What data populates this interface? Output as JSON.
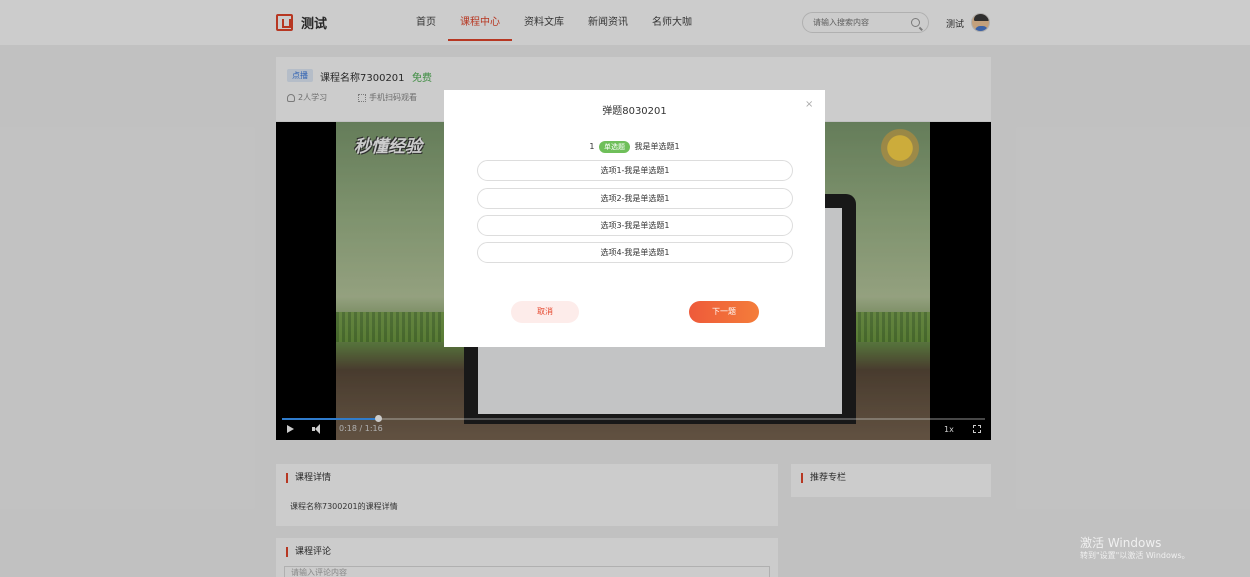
{
  "header": {
    "logo_text": "测试",
    "nav": [
      {
        "label": "首页",
        "active": false
      },
      {
        "label": "课程中心",
        "active": true
      },
      {
        "label": "资料文库",
        "active": false
      },
      {
        "label": "新闻资讯",
        "active": false
      },
      {
        "label": "名师大咖",
        "active": false
      }
    ],
    "search_placeholder": "请输入搜索内容",
    "user_name": "测试"
  },
  "course": {
    "tag": "点播",
    "name": "课程名称7300201",
    "price": "免费",
    "learners": "2人学习",
    "mobile": "手机扫码观看"
  },
  "player": {
    "watermark": "秒懂经验",
    "time": "0:18 / 1:16",
    "progress": 0.137,
    "rate": "1x"
  },
  "detail": {
    "title": "课程详情",
    "text": "课程名称7300201的课程详情"
  },
  "recommend": {
    "title": "推荐专栏"
  },
  "comments": {
    "title": "课程评论",
    "placeholder": "请输入评论内容"
  },
  "modal": {
    "title": "弹题8030201",
    "close": "×",
    "question_no": "1",
    "question_type": "单选题",
    "question_text": "我是单选题1",
    "options": [
      "选项1-我是单选题1",
      "选项2-我是单选题1",
      "选项3-我是单选题1",
      "选项4-我是单选题1"
    ],
    "cancel_label": "取消",
    "next_label": "下一题"
  },
  "windows": {
    "activate": "激活 Windows",
    "hint": "转到\"设置\"以激活 Windows。"
  },
  "colors": {
    "accent": "#e5452b",
    "free": "#4caf50",
    "badge": "#6fbf5a",
    "progress": "#3c9bff"
  }
}
